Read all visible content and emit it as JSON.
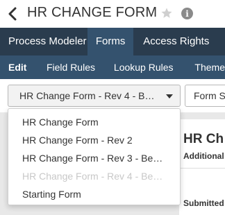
{
  "header": {
    "title": "HR CHANGE FORM",
    "back_icon": "chevron-left-icon",
    "favorite_icon": "star-icon",
    "info_icon": "info-icon",
    "info_glyph": "i"
  },
  "main_nav": {
    "items": [
      {
        "label": "Process Modeler",
        "active": false
      },
      {
        "label": "Forms",
        "active": true
      },
      {
        "label": "Access Rights",
        "active": false
      }
    ]
  },
  "sub_nav": {
    "items": [
      {
        "label": "Edit",
        "active": true
      },
      {
        "label": "Field Rules",
        "active": false
      },
      {
        "label": "Lookup Rules",
        "active": false
      },
      {
        "label": "Theme",
        "active": false
      }
    ]
  },
  "toolbar": {
    "revision_select_value": "HR Change Form - Rev 4 - B…",
    "settings_button_label": "Form S"
  },
  "revision_dropdown": {
    "options": [
      {
        "label": "HR Change Form",
        "disabled": false
      },
      {
        "label": "HR Change Form - Rev 2",
        "disabled": false
      },
      {
        "label": "HR Change Form - Rev 3 - Be…",
        "disabled": false
      },
      {
        "label": "HR Change Form - Rev 4 - Be…",
        "disabled": true
      },
      {
        "label": "Starting Form",
        "disabled": false
      }
    ]
  },
  "form_preview": {
    "title": "HR Ch",
    "subtitle": "Additional",
    "submitted_label": "Submitted"
  },
  "colors": {
    "main_nav_bg": "#2a3c4e",
    "active_tab_bg": "#34526e",
    "sub_nav_bg": "#34526e",
    "disabled_text": "#c8c8c8"
  }
}
